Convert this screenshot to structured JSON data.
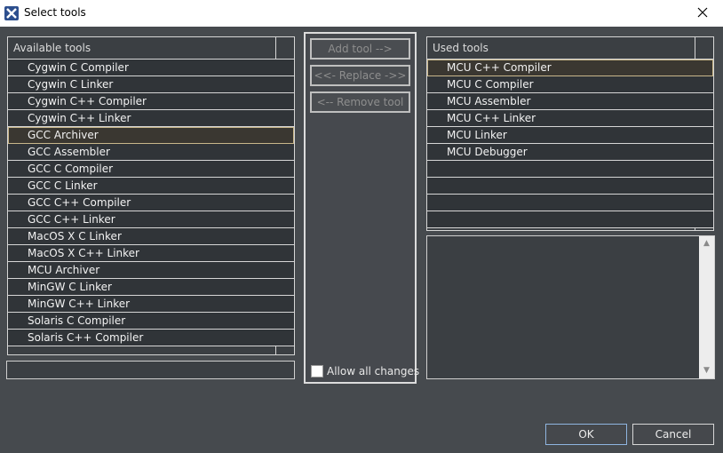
{
  "window": {
    "title": "Select tools"
  },
  "available": {
    "header": "Available tools",
    "items": [
      "Cygwin C Compiler",
      "Cygwin C Linker",
      "Cygwin C++ Compiler",
      "Cygwin C++ Linker",
      "GCC Archiver",
      "GCC Assembler",
      "GCC C Compiler",
      "GCC C Linker",
      "GCC C++ Compiler",
      "GCC C++ Linker",
      "MacOS X C Linker",
      "MacOS X C++ Linker",
      "MCU Archiver",
      "MinGW C Linker",
      "MinGW C++ Linker",
      "Solaris C Compiler",
      "Solaris C++ Compiler"
    ],
    "selected": "GCC Archiver"
  },
  "actions": {
    "add": "Add tool -->",
    "replace": "<<- Replace ->>",
    "remove": "<-- Remove tool",
    "allow_all": "Allow all changes"
  },
  "used": {
    "header": "Used tools",
    "items": [
      "MCU C++ Compiler",
      "MCU C Compiler",
      "MCU Assembler",
      "MCU C++ Linker",
      "MCU Linker",
      "MCU Debugger"
    ],
    "selected": "MCU C++ Compiler"
  },
  "buttons": {
    "ok": "OK",
    "cancel": "Cancel"
  },
  "colors": {
    "background": "#464a4e",
    "list_background": "#303438",
    "selection_outline": "#c8b68a",
    "ok_border": "#8fb5e0"
  }
}
